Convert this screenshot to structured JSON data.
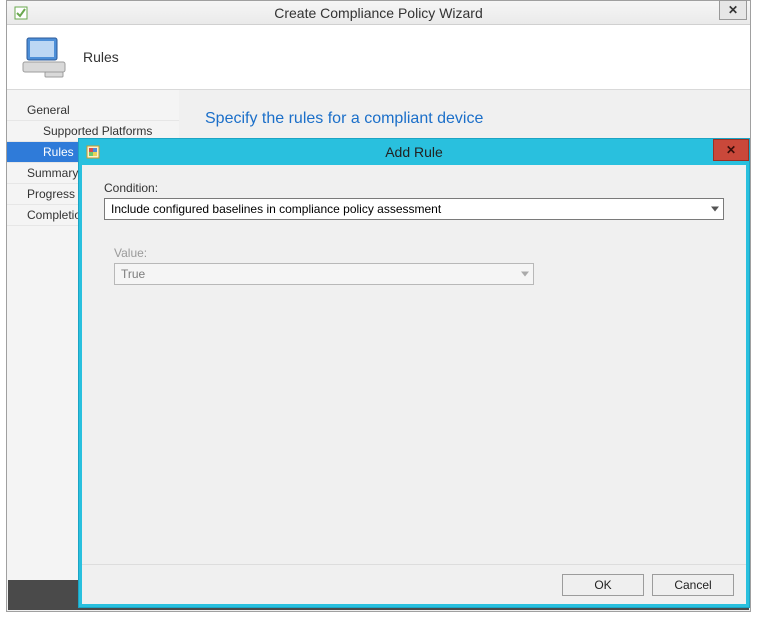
{
  "wizard": {
    "title": "Create Compliance Policy Wizard",
    "close_glyph": "✕",
    "header_label": "Rules",
    "sidebar": {
      "items": [
        {
          "label": "General",
          "level": 1,
          "selected": false
        },
        {
          "label": "Supported Platforms",
          "level": 2,
          "selected": false
        },
        {
          "label": "Rules",
          "level": 2,
          "selected": true
        },
        {
          "label": "Summary",
          "level": 1,
          "selected": false
        },
        {
          "label": "Progress",
          "level": 1,
          "selected": false
        },
        {
          "label": "Completion",
          "level": 1,
          "selected": false
        }
      ]
    },
    "main_heading": "Specify the rules for a compliant device"
  },
  "dialog": {
    "title": "Add Rule",
    "close_glyph": "✕",
    "condition_label": "Condition:",
    "condition_value": "Include configured baselines in compliance policy assessment",
    "value_label": "Value:",
    "value_value": "True",
    "ok_label": "OK",
    "cancel_label": "Cancel"
  }
}
